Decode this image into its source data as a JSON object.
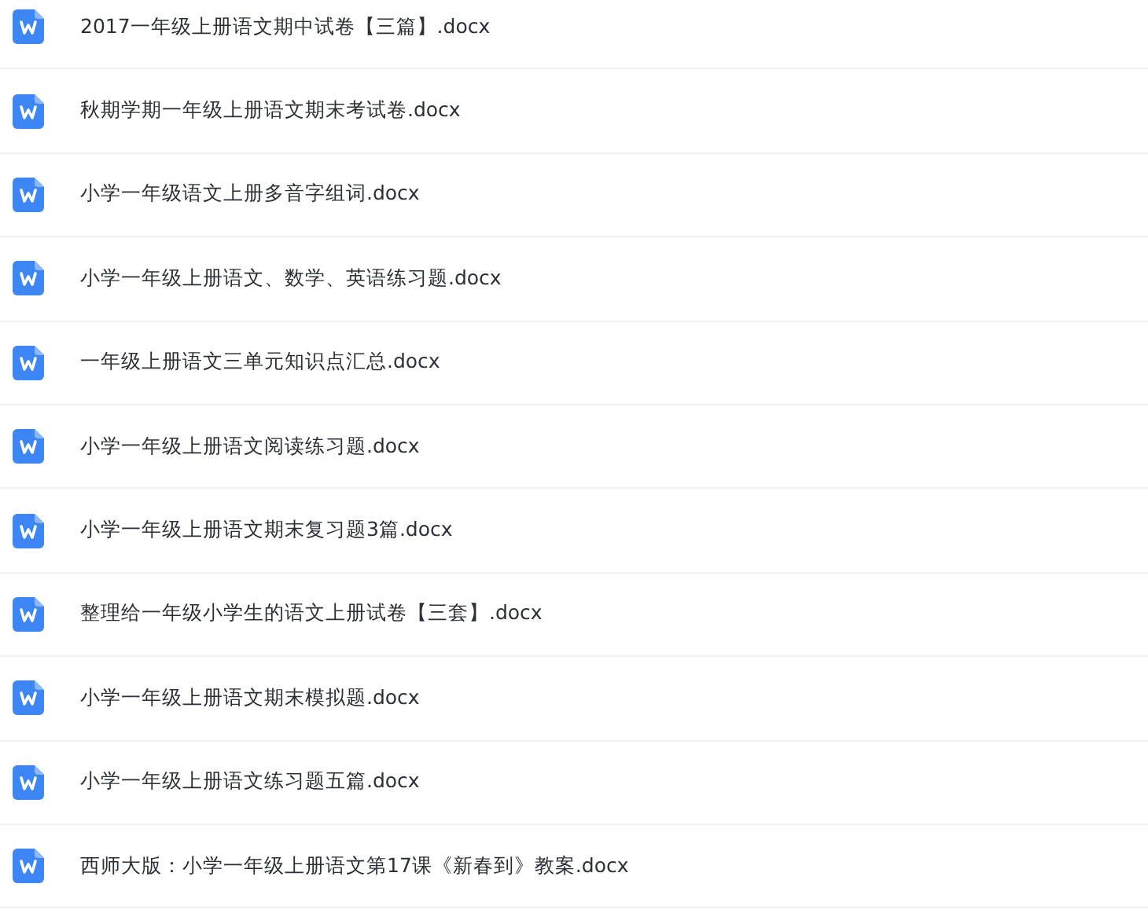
{
  "files": [
    {
      "name": "2017一年级上册语文期中试卷【三篇】.docx"
    },
    {
      "name": "秋期学期一年级上册语文期末考试卷.docx"
    },
    {
      "name": "小学一年级语文上册多音字组词.docx"
    },
    {
      "name": "小学一年级上册语文、数学、英语练习题.docx"
    },
    {
      "name": "一年级上册语文三单元知识点汇总.docx"
    },
    {
      "name": "小学一年级上册语文阅读练习题.docx"
    },
    {
      "name": "小学一年级上册语文期末复习题3篇.docx"
    },
    {
      "name": "整理给一年级小学生的语文上册试卷【三套】.docx"
    },
    {
      "name": "小学一年级上册语文期末模拟题.docx"
    },
    {
      "name": "小学一年级上册语文练习题五篇.docx"
    },
    {
      "name": "西师大版：小学一年级上册语文第17课《新春到》教案.docx"
    }
  ]
}
